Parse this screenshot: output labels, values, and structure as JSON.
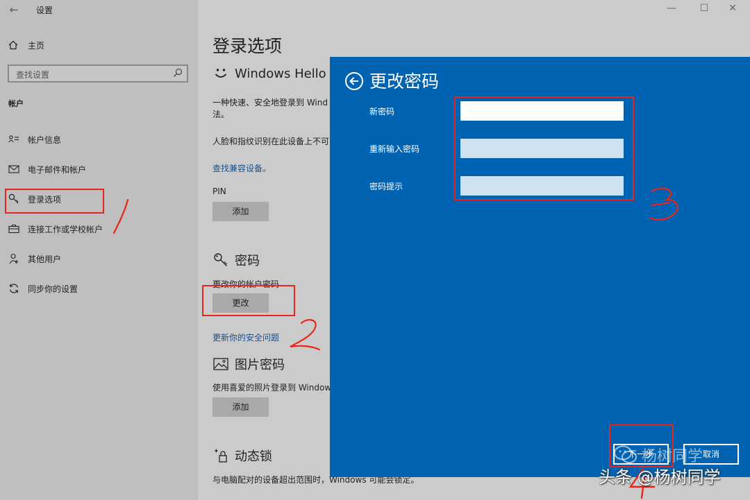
{
  "window": {
    "title": "设置",
    "controls": [
      "—",
      "☐",
      "✕"
    ]
  },
  "sidebar": {
    "home": "主页",
    "search_placeholder": "查找设置",
    "section": "帐户",
    "items": [
      {
        "label": "帐户信息",
        "icon": "account-info-icon"
      },
      {
        "label": "电子邮件和帐户",
        "icon": "mail-icon"
      },
      {
        "label": "登录选项",
        "icon": "key-icon"
      },
      {
        "label": "连接工作或学校帐户",
        "icon": "briefcase-icon"
      },
      {
        "label": "其他用户",
        "icon": "person-icon"
      },
      {
        "label": "同步你的设置",
        "icon": "sync-icon"
      }
    ]
  },
  "main": {
    "title": "登录选项",
    "hello": {
      "heading": "Windows Hello",
      "desc_line1": "一种快速、安全地登录到 Wind",
      "desc_line2": "法。",
      "note": "人脸和指纹识别在此设备上不可",
      "link": "查找兼容设备。"
    },
    "pin": {
      "label": "PIN",
      "button": "添加"
    },
    "password": {
      "heading": "密码",
      "desc": "更改你的帐户密码",
      "button": "更改",
      "link": "更新你的安全问题"
    },
    "picture_password": {
      "heading": "图片密码",
      "desc": "使用喜爱的照片登录到 Window",
      "button": "添加"
    },
    "dynamic_lock": {
      "heading": "动态锁",
      "desc": "与电脑配对的设备超出范围时，Windows 可能会锁定。"
    }
  },
  "dialog": {
    "title": "更改密码",
    "fields": [
      {
        "label": "新密码",
        "value": ""
      },
      {
        "label": "重新输入密码",
        "value": ""
      },
      {
        "label": "密码提示",
        "value": ""
      }
    ],
    "next_button": "下一步",
    "cancel_button": "取消"
  },
  "annotations": {
    "step1": "1",
    "step2": "2",
    "step3": "3",
    "step4": "4",
    "color": "#e8251b"
  },
  "watermark": {
    "ghost": "杨树同学",
    "main": "头条 @杨树同学"
  },
  "colors": {
    "dialog_bg": "#0063b1",
    "link": "#1b4f8c",
    "annotation": "#e8251b"
  }
}
